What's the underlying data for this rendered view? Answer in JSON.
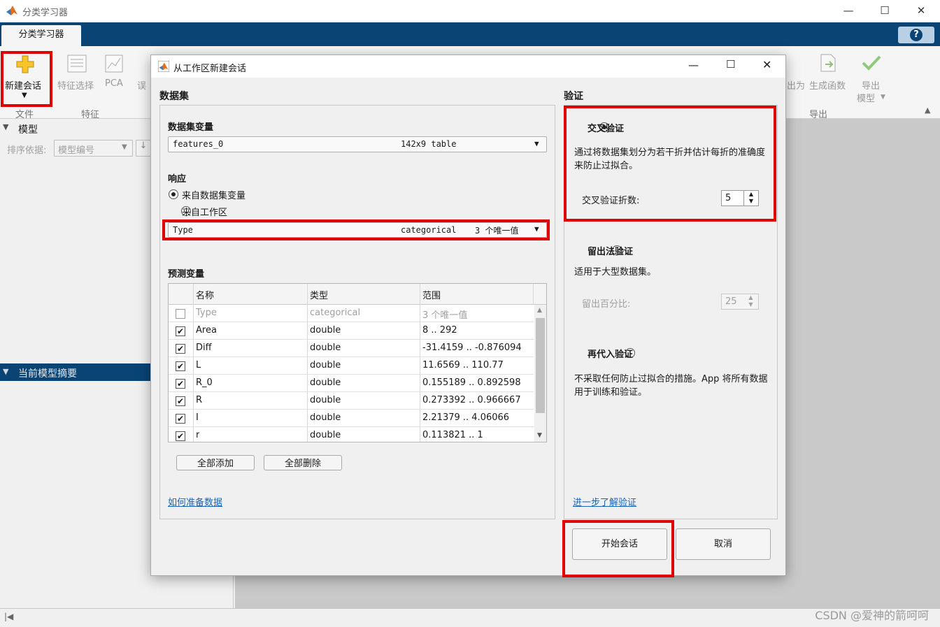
{
  "app": {
    "title": "分类学习器",
    "tab_label": "分类学习器",
    "help_glyph": "?"
  },
  "toolstrip": {
    "new_session": "新建会话",
    "feature_select": "特征选择",
    "pca": "PCA",
    "misclass": "误",
    "truncated_right": "出为",
    "generate_function": "生成函数",
    "export_model_line1": "导出",
    "export_model_line2": "模型",
    "section_file": "文件",
    "section_feature": "特征",
    "section_export": "导出"
  },
  "left_panel": {
    "models_header": "模型",
    "sort_by_label": "排序依据:",
    "sort_by_value": "模型编号",
    "summary_header": "当前模型摘要"
  },
  "dialog": {
    "title": "从工作区新建会话",
    "dataset": {
      "header": "数据集",
      "variable_label": "数据集变量",
      "variable_name": "features_0",
      "variable_size": "142x9 table",
      "response_label": "响应",
      "response_option_1": "来自数据集变量",
      "response_option_2": "来自工作区",
      "response_name": "Type",
      "response_type": "categorical",
      "response_count": "3 个唯一值",
      "predictors_label": "预测变量",
      "columns": [
        "名称",
        "类型",
        "范围"
      ],
      "rows": [
        {
          "checked": false,
          "name": "Type",
          "type": "categorical",
          "range": "3 个唯一值",
          "disabled": true
        },
        {
          "checked": true,
          "name": "Area",
          "type": "double",
          "range": "8 .. 292"
        },
        {
          "checked": true,
          "name": "Diff",
          "type": "double",
          "range": "-31.4159 .. -0.876094"
        },
        {
          "checked": true,
          "name": "L",
          "type": "double",
          "range": "11.6569 .. 110.77"
        },
        {
          "checked": true,
          "name": "R_0",
          "type": "double",
          "range": "0.155189 .. 0.892598"
        },
        {
          "checked": true,
          "name": "R",
          "type": "double",
          "range": "0.273392 .. 0.966667"
        },
        {
          "checked": true,
          "name": "I",
          "type": "double",
          "range": "2.21379 .. 4.06066"
        },
        {
          "checked": true,
          "name": "r",
          "type": "double",
          "range": "0.113821 .. 1"
        }
      ],
      "add_all": "全部添加",
      "remove_all": "全部删除",
      "help_link": "如何准备数据"
    },
    "validation": {
      "header": "验证",
      "cv_label": "交叉验证",
      "cv_desc": "通过将数据集划分为若干折并估计每折的准确度来防止过拟合。",
      "cv_folds_label": "交叉验证折数:",
      "cv_folds_value": "5",
      "holdout_label": "留出法验证",
      "holdout_desc": "适用于大型数据集。",
      "holdout_pct_label": "留出百分比:",
      "holdout_pct_value": "25",
      "resub_label": "再代入验证",
      "resub_desc": "不采取任何防止过拟合的措施。App 将所有数据用于训练和验证。",
      "learn_more": "进一步了解验证"
    },
    "start_button": "开始会话",
    "cancel_button": "取消"
  },
  "watermark": "CSDN @爱神的箭呵呵"
}
